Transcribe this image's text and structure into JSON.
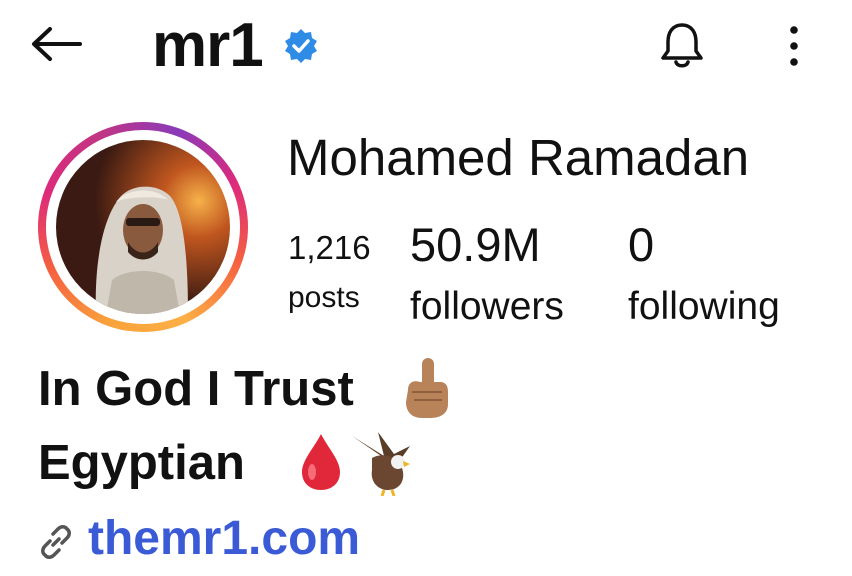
{
  "header": {
    "username": "mr1",
    "icons": [
      "back-arrow-icon",
      "verified-badge-icon",
      "bell-icon",
      "more-vertical-icon"
    ]
  },
  "profile": {
    "full_name": "Mohamed Ramadan",
    "stats": {
      "posts_count": "1,216",
      "posts_label": "posts",
      "followers_count": "50.9M",
      "followers_label": "followers",
      "following_count": "0",
      "following_label": "following"
    },
    "bio_line1": "In God I Trust",
    "bio_line2": "Egyptian",
    "link": "themr1.com"
  },
  "colors": {
    "verified": "#2f8ce6",
    "link": "#3b5bd6",
    "ring": [
      "#f9a23b",
      "#dd2a7b",
      "#8a3ab9"
    ]
  }
}
